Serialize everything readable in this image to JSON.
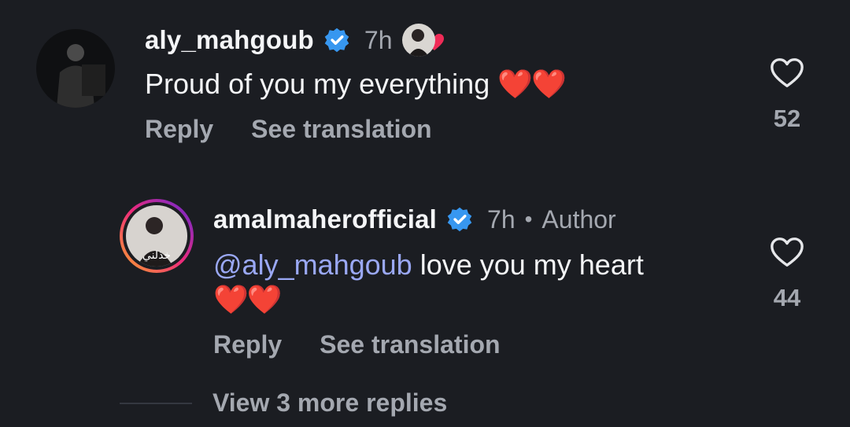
{
  "comments": [
    {
      "username": "aly_mahgoub",
      "time": "7h",
      "text": "Proud of you my everything",
      "emoji": "❤️❤️",
      "actions": [
        "Reply",
        "See translation"
      ],
      "likes": "52",
      "verified": true,
      "reaction": "heart"
    },
    {
      "username": "amalmaherofficial",
      "time": "7h",
      "author_badge": "Author",
      "mention": "@aly_mahgoub",
      "text": " love you my heart",
      "emoji": "❤️❤️",
      "actions": [
        "Reply",
        "See translation"
      ],
      "likes": "44",
      "verified": true
    }
  ],
  "view_more": "View 3 more replies",
  "colors": {
    "background": "#1b1d22",
    "verified": "#3797f0",
    "mention": "#9aa8f5",
    "heart": "#ef2b57",
    "muted": "#a4a8b0"
  }
}
